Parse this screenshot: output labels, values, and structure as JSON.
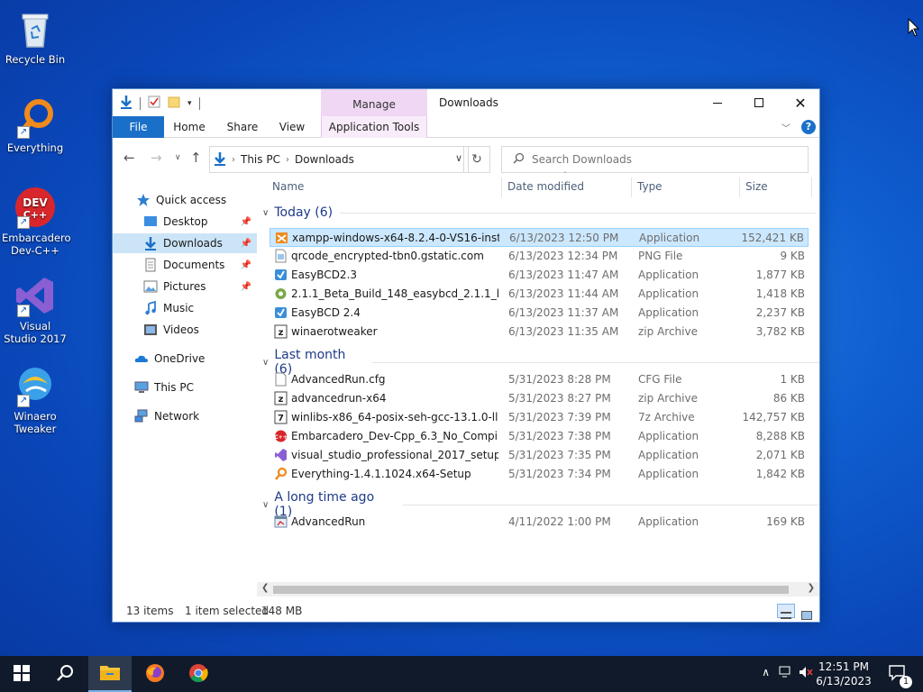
{
  "desktop": {
    "icons": [
      {
        "label": "Recycle Bin"
      },
      {
        "label": "Everything"
      },
      {
        "label": "Embarcadero Dev-C++"
      },
      {
        "label": "Visual Studio 2017"
      },
      {
        "label": "Winaero Tweaker"
      }
    ]
  },
  "window": {
    "title": "Downloads",
    "manage_label": "Manage",
    "ribbon_tabs": {
      "file": "File",
      "home": "Home",
      "share": "Share",
      "view": "View",
      "app_tools": "Application Tools"
    },
    "address": {
      "root": "This PC",
      "current": "Downloads"
    },
    "search_placeholder": "Search Downloads"
  },
  "navpane": {
    "quick_access": "Quick access",
    "desktop": "Desktop",
    "downloads": "Downloads",
    "documents": "Documents",
    "pictures": "Pictures",
    "music": "Music",
    "videos": "Videos",
    "onedrive": "OneDrive",
    "this_pc": "This PC",
    "network": "Network"
  },
  "columns": {
    "name": "Name",
    "date": "Date modified",
    "type": "Type",
    "size": "Size"
  },
  "groups": [
    {
      "label": "Today (6)",
      "files": [
        {
          "name": "xampp-windows-x64-8.2.4-0-VS16-instal...",
          "date": "6/13/2023 12:50 PM",
          "type": "Application",
          "size": "152,421 KB",
          "icon": "xampp-icon"
        },
        {
          "name": "qrcode_encrypted-tbn0.gstatic.com",
          "date": "6/13/2023 12:34 PM",
          "type": "PNG File",
          "size": "9 KB",
          "icon": "png-icon"
        },
        {
          "name": "EasyBCD2.3",
          "date": "6/13/2023 11:47 AM",
          "type": "Application",
          "size": "1,877 KB",
          "icon": "easybcd-icon"
        },
        {
          "name": "2.1.1_Beta_Build_148_easybcd_2.1.1_beta_...",
          "date": "6/13/2023 11:44 AM",
          "type": "Application",
          "size": "1,418 KB",
          "icon": "setup-icon"
        },
        {
          "name": "EasyBCD 2.4",
          "date": "6/13/2023 11:37 AM",
          "type": "Application",
          "size": "2,237 KB",
          "icon": "easybcd-icon"
        },
        {
          "name": "winaerotweaker",
          "date": "6/13/2023 11:35 AM",
          "type": "zip Archive",
          "size": "3,782 KB",
          "icon": "zip-icon"
        }
      ]
    },
    {
      "label": "Last month (6)",
      "files": [
        {
          "name": "AdvancedRun.cfg",
          "date": "5/31/2023 8:28 PM",
          "type": "CFG File",
          "size": "1 KB",
          "icon": "cfg-icon"
        },
        {
          "name": "advancedrun-x64",
          "date": "5/31/2023 8:27 PM",
          "type": "zip Archive",
          "size": "86 KB",
          "icon": "zip-icon"
        },
        {
          "name": "winlibs-x86_64-posix-seh-gcc-13.1.0-llv...",
          "date": "5/31/2023 7:39 PM",
          "type": "7z Archive",
          "size": "142,757 KB",
          "icon": "7z-icon"
        },
        {
          "name": "Embarcadero_Dev-Cpp_6.3_No_Compiler...",
          "date": "5/31/2023 7:38 PM",
          "type": "Application",
          "size": "8,288 KB",
          "icon": "devcpp-icon"
        },
        {
          "name": "visual_studio_professional_2017_setup",
          "date": "5/31/2023 7:35 PM",
          "type": "Application",
          "size": "2,071 KB",
          "icon": "vs-icon"
        },
        {
          "name": "Everything-1.4.1.1024.x64-Setup",
          "date": "5/31/2023 7:34 PM",
          "type": "Application",
          "size": "1,842 KB",
          "icon": "everything-icon"
        }
      ]
    },
    {
      "label": "A long time ago (1)",
      "files": [
        {
          "name": "AdvancedRun",
          "date": "4/11/2022 1:00 PM",
          "type": "Application",
          "size": "169 KB",
          "icon": "advancedrun-icon"
        }
      ]
    }
  ],
  "status": {
    "items": "13 items",
    "selected": "1 item selected",
    "size": "148 MB"
  },
  "taskbar": {
    "time": "12:51 PM",
    "date": "6/13/2023",
    "notification_count": "1"
  }
}
